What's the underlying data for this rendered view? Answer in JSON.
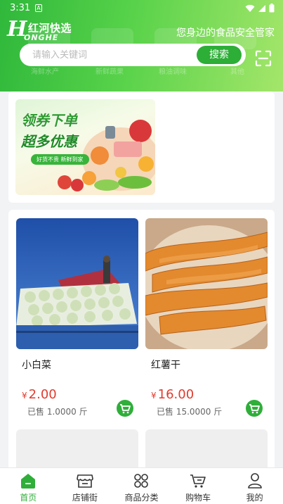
{
  "status_bar": {
    "time": "3:31",
    "notification_badge": "A"
  },
  "header": {
    "logo_mark": "H",
    "logo_cn": "红河快选",
    "logo_en": "ONGHE",
    "slogan": "您身边的食品安全管家"
  },
  "search": {
    "placeholder": "请输入关键词",
    "button_label": "搜索"
  },
  "background_categories": [
    "海鲜水产",
    "新鲜蔬果",
    "粮油调味",
    "其他"
  ],
  "banner": {
    "line1": "领券下单",
    "line2": "超多优惠",
    "tagline": "好货不贵 新鲜到家"
  },
  "products": [
    {
      "name": "小白菜",
      "currency": "¥",
      "price": "2.00",
      "sold": "已售 1.0000 斤"
    },
    {
      "name": "红薯干",
      "currency": "¥",
      "price": "16.00",
      "sold": "已售 15.0000 斤"
    }
  ],
  "tabbar": [
    {
      "label": "首页",
      "active": true
    },
    {
      "label": "店铺街",
      "active": false
    },
    {
      "label": "商品分类",
      "active": false
    },
    {
      "label": "购物车",
      "active": false
    },
    {
      "label": "我的",
      "active": false
    }
  ],
  "colors": {
    "brand_green": "#2fae3a",
    "price_red": "#e23b2e"
  }
}
